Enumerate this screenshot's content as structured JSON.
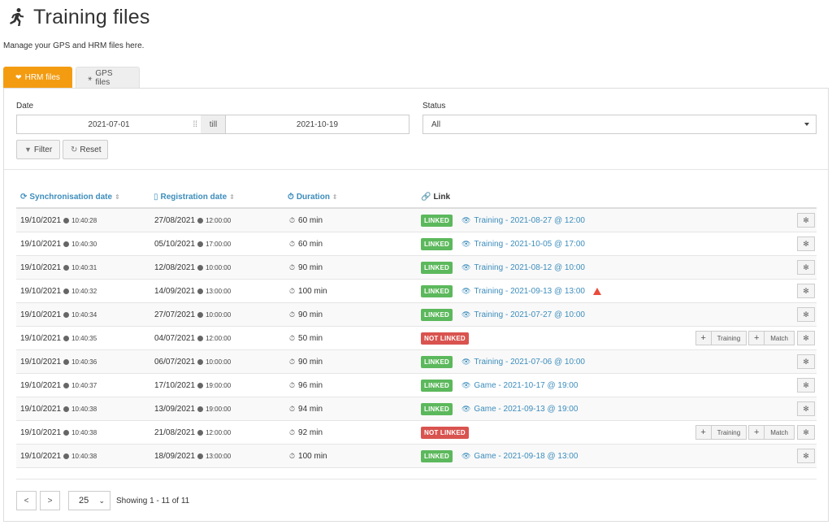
{
  "page": {
    "title": "Training files",
    "subtitle": "Manage your GPS and HRM files here."
  },
  "tabs": [
    {
      "label": "HRM files",
      "icon": "heart-icon",
      "active": true
    },
    {
      "label": "GPS files",
      "icon": "satellite-icon",
      "active": false
    }
  ],
  "filters": {
    "date_label": "Date",
    "date_from": "2021-07-01",
    "till_label": "till",
    "date_to": "2021-10-19",
    "status_label": "Status",
    "status_value": "All",
    "filter_button": "Filter",
    "reset_button": "Reset"
  },
  "table": {
    "headers": {
      "sync": "Synchronisation date",
      "registration": "Registration date",
      "duration": "Duration",
      "link": "Link"
    },
    "rows": [
      {
        "sync_date": "19/10/2021",
        "sync_time": "10:40:28",
        "reg_date": "27/08/2021",
        "reg_time": "12:00:00",
        "duration": "60 min",
        "status": "LINKED",
        "link_text": "Training - 2021-08-27 @ 12:00",
        "warning": false,
        "actions": false
      },
      {
        "sync_date": "19/10/2021",
        "sync_time": "10:40:30",
        "reg_date": "05/10/2021",
        "reg_time": "17:00:00",
        "duration": "60 min",
        "status": "LINKED",
        "link_text": "Training - 2021-10-05 @ 17:00",
        "warning": false,
        "actions": false
      },
      {
        "sync_date": "19/10/2021",
        "sync_time": "10:40:31",
        "reg_date": "12/08/2021",
        "reg_time": "10:00:00",
        "duration": "90 min",
        "status": "LINKED",
        "link_text": "Training - 2021-08-12 @ 10:00",
        "warning": false,
        "actions": false
      },
      {
        "sync_date": "19/10/2021",
        "sync_time": "10:40:32",
        "reg_date": "14/09/2021",
        "reg_time": "13:00:00",
        "duration": "100 min",
        "status": "LINKED",
        "link_text": "Training - 2021-09-13 @ 13:00",
        "warning": true,
        "actions": false
      },
      {
        "sync_date": "19/10/2021",
        "sync_time": "10:40:34",
        "reg_date": "27/07/2021",
        "reg_time": "10:00:00",
        "duration": "90 min",
        "status": "LINKED",
        "link_text": "Training - 2021-07-27 @ 10:00",
        "warning": false,
        "actions": false
      },
      {
        "sync_date": "19/10/2021",
        "sync_time": "10:40:35",
        "reg_date": "04/07/2021",
        "reg_time": "12:00:00",
        "duration": "50 min",
        "status": "NOT LINKED",
        "link_text": "",
        "warning": false,
        "actions": true
      },
      {
        "sync_date": "19/10/2021",
        "sync_time": "10:40:36",
        "reg_date": "06/07/2021",
        "reg_time": "10:00:00",
        "duration": "90 min",
        "status": "LINKED",
        "link_text": "Training - 2021-07-06 @ 10:00",
        "warning": false,
        "actions": false
      },
      {
        "sync_date": "19/10/2021",
        "sync_time": "10:40:37",
        "reg_date": "17/10/2021",
        "reg_time": "19:00:00",
        "duration": "96 min",
        "status": "LINKED",
        "link_text": "Game - 2021-10-17 @ 19:00",
        "warning": false,
        "actions": false
      },
      {
        "sync_date": "19/10/2021",
        "sync_time": "10:40:38",
        "reg_date": "13/09/2021",
        "reg_time": "19:00:00",
        "duration": "94 min",
        "status": "LINKED",
        "link_text": "Game - 2021-09-13 @ 19:00",
        "warning": false,
        "actions": false
      },
      {
        "sync_date": "19/10/2021",
        "sync_time": "10:40:38",
        "reg_date": "21/08/2021",
        "reg_time": "12:00:00",
        "duration": "92 min",
        "status": "NOT LINKED",
        "link_text": "",
        "warning": false,
        "actions": true
      },
      {
        "sync_date": "19/10/2021",
        "sync_time": "10:40:38",
        "reg_date": "18/09/2021",
        "reg_time": "13:00:00",
        "duration": "100 min",
        "status": "LINKED",
        "link_text": "Game - 2021-09-18 @ 13:00",
        "warning": false,
        "actions": false
      }
    ],
    "action_labels": {
      "training": "Training",
      "match": "Match"
    }
  },
  "pagination": {
    "prev": "<",
    "next": ">",
    "page_size": "25",
    "showing": "Showing 1 - 11 of 11"
  },
  "colors": {
    "accent": "#f39c12",
    "link": "#3c8dbc",
    "linked": "#5cb85c",
    "not_linked": "#d9534f"
  }
}
